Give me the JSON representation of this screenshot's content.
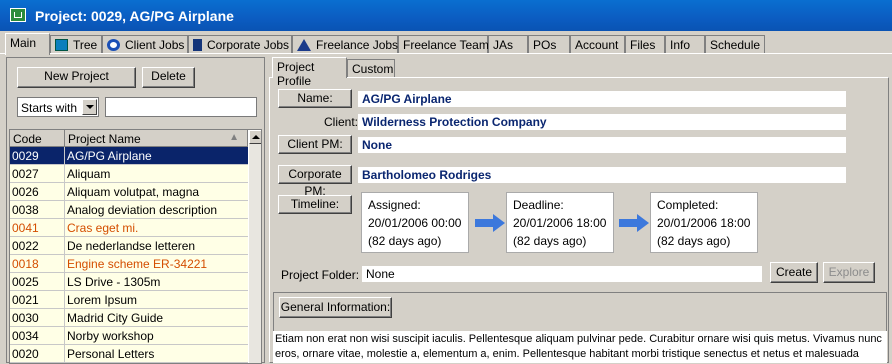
{
  "window": {
    "title": "Project: 0029, AG/PG Airplane"
  },
  "tabs": [
    {
      "label": "Main",
      "icon": null
    },
    {
      "label": "Tree",
      "icon": "tree-icon"
    },
    {
      "label": "Client Jobs",
      "icon": "client-icon"
    },
    {
      "label": "Corporate Jobs",
      "icon": "building-icon"
    },
    {
      "label": "Freelance Jobs",
      "icon": "house-icon"
    },
    {
      "label": "Freelance Team",
      "icon": null
    },
    {
      "label": "JAs",
      "icon": null
    },
    {
      "label": "POs",
      "icon": null
    },
    {
      "label": "Account",
      "icon": null
    },
    {
      "label": "Files",
      "icon": null
    },
    {
      "label": "Info",
      "icon": null
    },
    {
      "label": "Schedule",
      "icon": null
    }
  ],
  "left": {
    "new_project": "New Project",
    "delete": "Delete",
    "filter_mode": "Starts with",
    "filter_value": "",
    "columns": [
      "Code",
      "Project Name"
    ],
    "rows": [
      {
        "code": "0029",
        "name": "AG/PG Airplane",
        "state": "selected"
      },
      {
        "code": "0027",
        "name": "Aliquam",
        "state": "normal"
      },
      {
        "code": "0026",
        "name": "Aliquam volutpat, magna",
        "state": "normal"
      },
      {
        "code": "0038",
        "name": "Analog deviation description",
        "state": "normal"
      },
      {
        "code": "0041",
        "name": "Cras eget mi.",
        "state": "orange"
      },
      {
        "code": "0022",
        "name": "De nederlandse letteren",
        "state": "normal"
      },
      {
        "code": "0018",
        "name": "Engine scheme ER-34221",
        "state": "orange"
      },
      {
        "code": "0025",
        "name": "LS Drive - 1305m",
        "state": "normal"
      },
      {
        "code": "0021",
        "name": "Lorem Ipsum",
        "state": "normal"
      },
      {
        "code": "0030",
        "name": "Madrid City Guide",
        "state": "normal"
      },
      {
        "code": "0034",
        "name": "Norby workshop",
        "state": "normal"
      },
      {
        "code": "0020",
        "name": "Personal Letters",
        "state": "normal"
      }
    ]
  },
  "right": {
    "subtabs": [
      "Project Profile",
      "Custom"
    ],
    "name_btn": "Name:",
    "name_value": "AG/PG Airplane",
    "client_label": "Client:",
    "client_value": "Wilderness Protection Company",
    "client_pm_btn": "Client PM:",
    "client_pm_value": "None",
    "corp_pm_btn": "Corporate PM:",
    "corp_pm_value": "Bartholomeo Rodriges",
    "timeline_btn": "Timeline:",
    "timeline": [
      {
        "label": "Assigned:",
        "date": "20/01/2006 00:00",
        "ago": "(82 days ago)"
      },
      {
        "label": "Deadline:",
        "date": "20/01/2006 18:00",
        "ago": "(82 days ago)"
      },
      {
        "label": "Completed:",
        "date": "20/01/2006 18:00",
        "ago": "(82 days ago)"
      }
    ],
    "folder_label": "Project Folder:",
    "folder_value": "None",
    "create_btn": "Create",
    "explore_btn": "Explore",
    "gi_btn": "General Information:",
    "description": "Etiam non erat non wisi suscipit iaculis. Pellentesque aliquam pulvinar pede. Curabitur ornare wisi quis metus. Vivamus nunc eros, ornare vitae, molestie a, elementum a, enim. Pellentesque habitant morbi tristique senectus et netus et malesuada fames"
  }
}
